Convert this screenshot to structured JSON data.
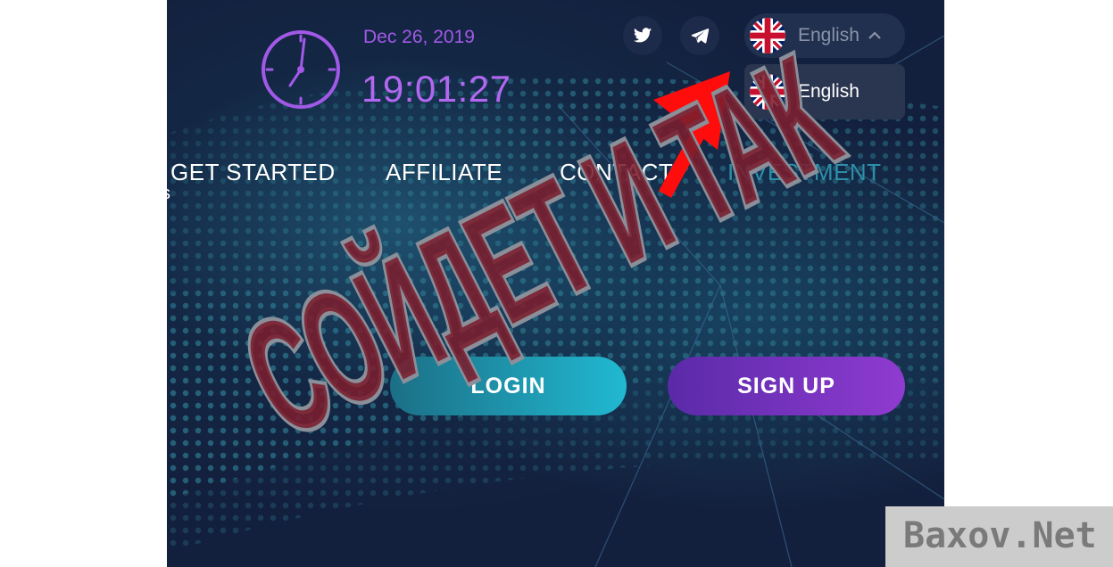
{
  "header": {
    "date": "Dec 26, 2019",
    "time": "19:01:27"
  },
  "social": [
    {
      "name": "twitter",
      "icon": "twitter-icon"
    },
    {
      "name": "telegram",
      "icon": "telegram-icon"
    }
  ],
  "language": {
    "selected": "English",
    "options": [
      "English"
    ]
  },
  "nav": {
    "items": [
      "GET STARTED",
      "AFFILIATE",
      "CONTACT",
      "INVESTMENT"
    ]
  },
  "buttons": {
    "login": "LOGIN",
    "signup": "SIGN UP"
  },
  "overlay": {
    "stamp_text": "СОЙДЕТ И ТАК",
    "watermark": "Baxov.Net"
  },
  "colors": {
    "background": "#13203d",
    "accent_purple": "#b267f0",
    "login_gradient_end": "#21b9d1",
    "signup_gradient_end": "#8f3bd0",
    "stamp_fill": "#7a1e2e",
    "arrow": "#ff0d0d"
  }
}
